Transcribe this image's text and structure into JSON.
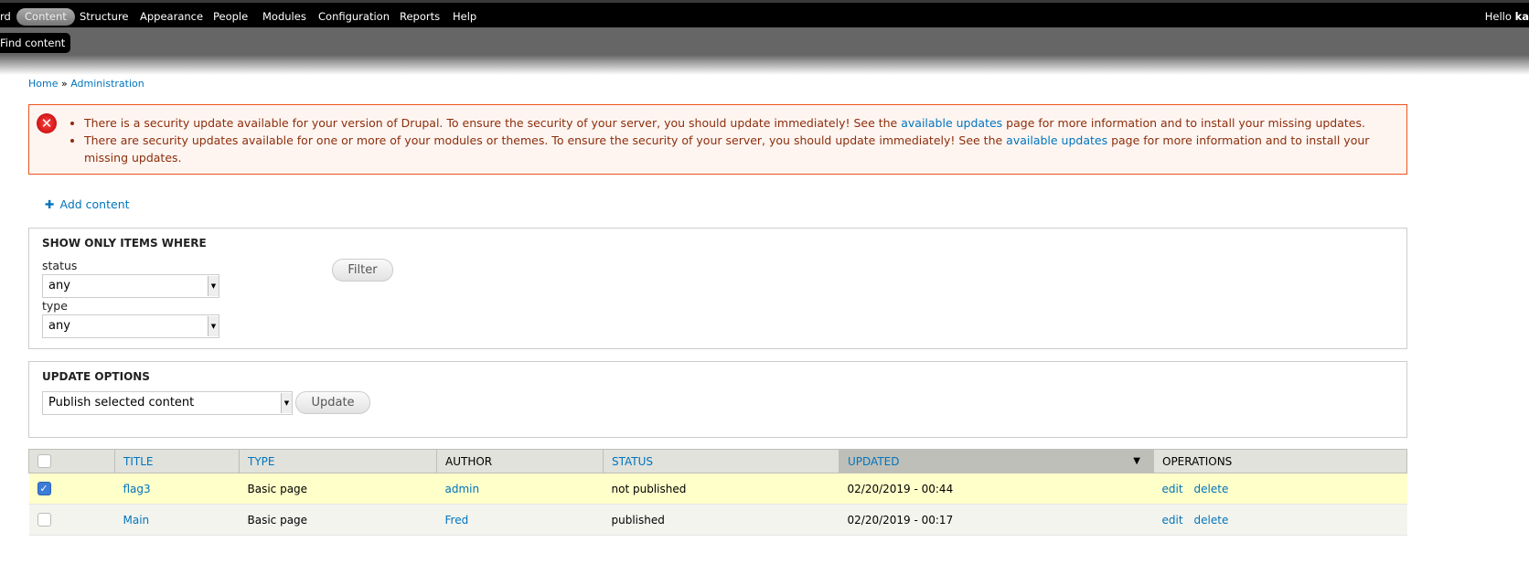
{
  "toolbar": {
    "items": [
      "rd",
      "Content",
      "Structure",
      "Appearance",
      "People",
      "Modules",
      "Configuration",
      "Reports",
      "Help"
    ],
    "hello": "Hello",
    "user": "ka",
    "shortcut": "Find content"
  },
  "breadcrumb": {
    "home": "Home",
    "sep": " » ",
    "admin": "Administration"
  },
  "messages": {
    "m1_pre": "There is a security update available for your version of Drupal. To ensure the security of your server, you should update immediately! See the ",
    "m1_link": "available updates",
    "m1_post": " page for more information and to install your missing updates.",
    "m2_pre": "There are security updates available for one or more of your modules or themes. To ensure the security of your server, you should update immediately! See the ",
    "m2_link": "available updates",
    "m2_post": " page for more information and to install your missing updates."
  },
  "add_content": "Add content",
  "filter": {
    "legend": "SHOW ONLY ITEMS WHERE",
    "status_label": "status",
    "status_value": "any",
    "type_label": "type",
    "type_value": "any",
    "button": "Filter"
  },
  "update": {
    "legend": "UPDATE OPTIONS",
    "value": "Publish selected content",
    "button": "Update"
  },
  "table": {
    "headers": [
      "TITLE",
      "TYPE",
      "AUTHOR",
      "STATUS",
      "UPDATED",
      "OPERATIONS"
    ],
    "rows": [
      {
        "checked": true,
        "title": "flag3",
        "type": "Basic page",
        "author": "admin",
        "status": "not published",
        "updated": "02/20/2019 - 00:44",
        "edit": "edit",
        "delete": "delete"
      },
      {
        "checked": false,
        "title": "Main",
        "type": "Basic page",
        "author": "Fred",
        "status": "published",
        "updated": "02/20/2019 - 00:17",
        "edit": "edit",
        "delete": "delete"
      }
    ]
  }
}
